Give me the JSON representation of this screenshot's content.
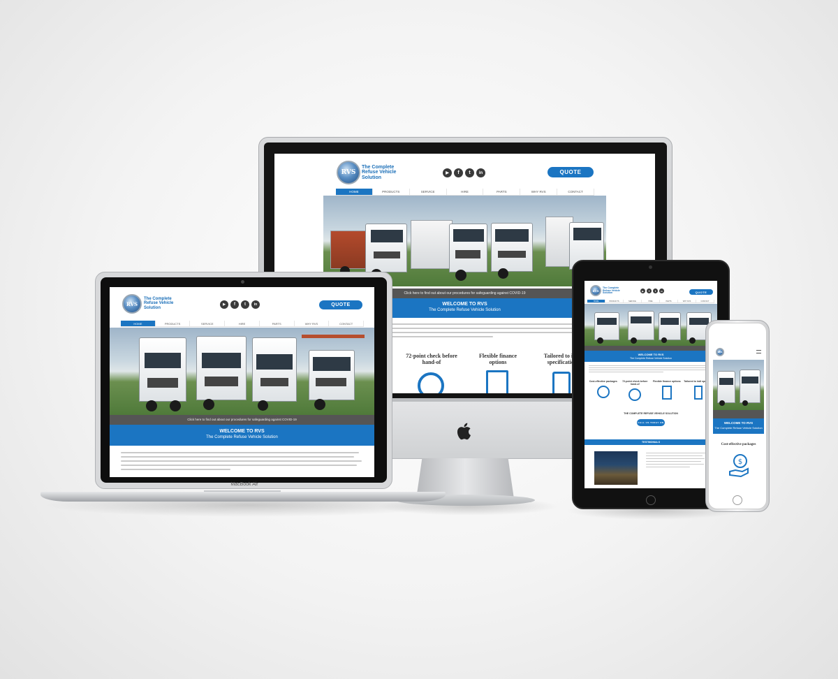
{
  "site": {
    "logo_initials": "RVS",
    "logo_line1": "The Complete",
    "logo_line2": "Refuse Vehicle",
    "logo_line3": "Solution",
    "quote": "QUOTE",
    "social": [
      "▶",
      "f",
      "t",
      "in"
    ],
    "nav": [
      "HOME",
      "PRODUCTS",
      "SERVICE",
      "HIRE",
      "PARTS",
      "WHY RVS",
      "CONTACT"
    ],
    "covid_desktop": "Click here to find out about our procedures for safeguarding against COVID-19",
    "covid_laptop": "Click here to find out about our procedures for safeguarding against COVID-19",
    "welcome_title": "WELCOME TO RVS",
    "welcome_sub": "The Complete Refuse Vehicle Solution",
    "feature_1": "72-point check before hand-of",
    "feature_2": "Flexible finance options",
    "feature_3": "Tailored to indi specification",
    "tablet_features": [
      "Cost-effective packages",
      "72-point check before hand-of",
      "Flexible finance options",
      "Tailored to indi specificat"
    ],
    "tablet_cta_heading": "THE COMPLETE REFUSE VEHICLE SOLUTION",
    "tablet_cta_button": "CALL US TODAY ON",
    "tablet_testimonials": "TESTIMONIALS",
    "phone_feature": "Cost-effective packages"
  },
  "devices": {
    "laptop_label": "MacBook Air"
  },
  "colors": {
    "brand_blue": "#1b75c2",
    "dark_bar": "#555555",
    "social_dark": "#3a3a3a"
  }
}
